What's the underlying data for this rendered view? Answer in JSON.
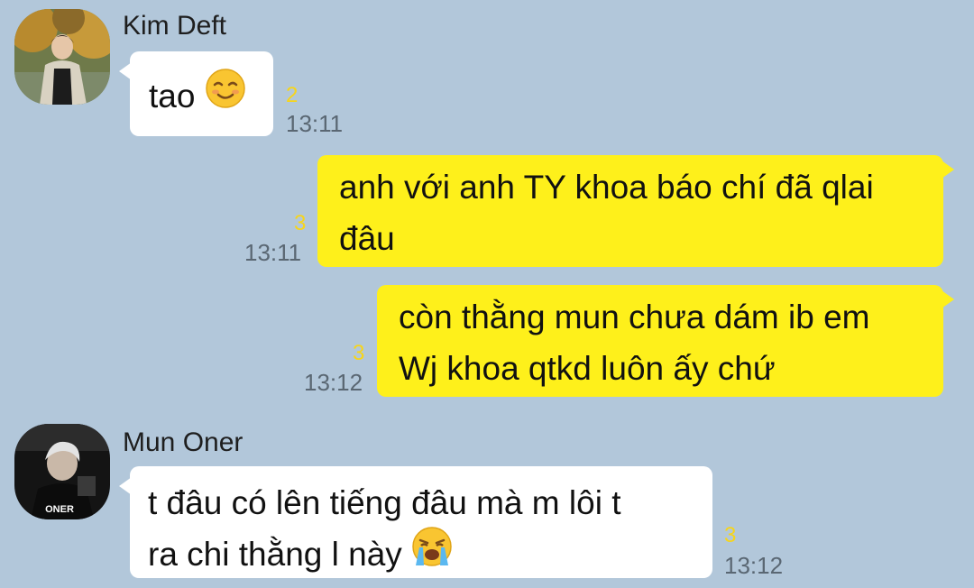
{
  "messages": [
    {
      "sender": "Kim Deft",
      "text_lines": [
        "tao"
      ],
      "unread": "2",
      "time": "13:11"
    },
    {
      "text_lines": [
        "anh với anh TY khoa báo chí đã qlai",
        "đâu"
      ],
      "unread": "3",
      "time": "13:11"
    },
    {
      "text_lines": [
        "còn thằng mun chưa dám ib em",
        "Wj khoa qtkd luôn ấy chứ"
      ],
      "unread": "3",
      "time": "13:12"
    },
    {
      "sender": "Mun Oner",
      "text_lines": [
        "t đâu có lên tiếng đâu mà m lôi t",
        "ra chi thằng l này"
      ],
      "unread": "3",
      "time": "13:12"
    }
  ],
  "avatar_jacket_text": "ONER",
  "colors": {
    "background": "#b2c7da",
    "outgoing_bubble": "#fef01b",
    "incoming_bubble": "#ffffff",
    "unread": "#f7d51a"
  },
  "emoji_icons": [
    "smiling-emoji-icon",
    "crying-emoji-icon"
  ]
}
